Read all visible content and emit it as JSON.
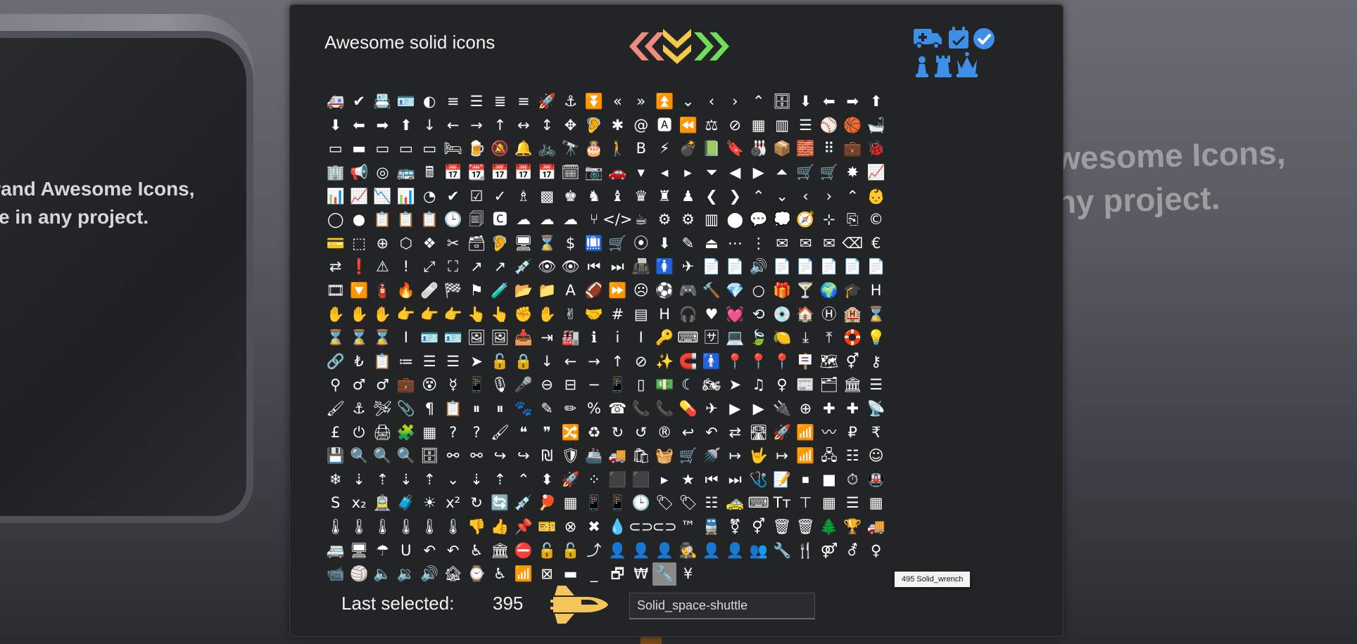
{
  "background": {
    "left_text": "Brand Awesome Icons,\nure in any project.",
    "right_text": "wesome Icons,\nny project."
  },
  "panel": {
    "title": "Awesome solid icons",
    "nav_icons": [
      "angle-double-left-icon",
      "angle-double-down-icon",
      "angle-double-right-icon"
    ],
    "header_icons": [
      "ambulance-icon",
      "calendar-check-icon",
      "check-circle-icon",
      "chess-pawn-icon",
      "chess-rook-icon",
      "chess-queen-icon"
    ],
    "colors": {
      "left_arrow": "#f08a7e",
      "down_arrow": "#f7c948",
      "right_arrow": "#6fdc5a",
      "accent_blue": "#3d8fe8",
      "shuttle": "#f6c55a"
    }
  },
  "grid": {
    "rows": [
      [
        "🚑",
        "✔",
        "📇",
        "🪪",
        "◐",
        "≡",
        "☰",
        "≣",
        "≡",
        "🚀",
        "⚓",
        "⏬",
        "«",
        "»",
        "⏫",
        "⌄",
        "‹",
        "›",
        "⌃",
        "🗄",
        "⬇",
        "⬅",
        "➡",
        "⬆",
        "⬇"
      ],
      [
        "⬅",
        "➡",
        "⬆",
        "↓",
        "←",
        "→",
        "↑",
        "↔",
        "↕",
        "✥",
        "🦻",
        "✱",
        "@",
        "🅰",
        "⏪",
        "⚖",
        "⊘",
        "▦",
        "▥",
        "☰",
        "⚾",
        "🏀",
        "🛁",
        "▭",
        "▬"
      ],
      [
        "▭",
        "▭",
        "▭",
        "🛏",
        "🍺",
        "🔕",
        "🔔",
        "🚲",
        "🔭",
        "🎂",
        "🚶",
        "B",
        "⚡",
        "💣",
        "📗",
        "🔖",
        "🎳",
        "📦",
        "🧱",
        "⠿",
        "💼",
        "🐞",
        "🏢",
        "📢",
        "◎"
      ],
      [
        "🚌",
        "🖩",
        "📅",
        "📆",
        "📅",
        "📅",
        "📅",
        "🗓",
        "📷",
        "🚗",
        "▾",
        "◂",
        "▸",
        "⏷",
        "◀",
        "▶",
        "⏶",
        "🛒",
        "🛒",
        "✸",
        "📈",
        "📊",
        "📈",
        "📉",
        "📊"
      ],
      [
        "◔",
        "✔",
        "☑",
        "✓",
        "♗",
        "▩",
        "♚",
        "♞",
        "♝",
        "♛",
        "♜",
        "♟",
        "❮",
        "❯",
        "⌃",
        "⌄",
        "‹",
        "›",
        "⌃",
        "👶",
        "◯",
        "●",
        "📋",
        "📋",
        "📋"
      ],
      [
        "🕒",
        "🗐",
        "🅲",
        "☁",
        "☁",
        "☁",
        "⑂",
        "</>",
        "☕",
        "⚙",
        "⚙",
        "▥",
        "⬤",
        "💬",
        "💭",
        "🧭",
        "⊹",
        "⎘",
        "©",
        "💳",
        "⬚",
        "⊕",
        "⬡",
        "❖",
        "✂"
      ],
      [
        "🗃",
        "🦻",
        "🖥",
        "⌛",
        "$",
        "🛄",
        "🛒",
        "⦿",
        "⬇",
        "✎",
        "⏏",
        "⋯",
        "⋮",
        "✉",
        "✉",
        "✉",
        "⌫",
        "€",
        "⇄",
        "❗",
        "⚠",
        "!",
        "⤢",
        "⛶",
        "↗"
      ],
      [
        "↗",
        "💉",
        "👁",
        "👁",
        "⏮",
        "⏭",
        "📠",
        "🚺",
        "✈",
        "📄",
        "📄",
        "🔊",
        "📄",
        "📄",
        "📄",
        "📄",
        "📄",
        "🎞",
        "🔽",
        "🧯",
        "🔥",
        "🩹",
        "🏁",
        "⚑"
      ],
      [
        "🧪",
        "📂",
        "📁",
        "A",
        "🏈",
        "⏩",
        "☹",
        "⚽",
        "🎮",
        "🔨",
        "💎",
        "○",
        "🎁",
        "🍸",
        "🌍",
        "🎓",
        "H",
        "✋",
        "✋",
        "✋",
        "👉",
        "👉",
        "👉",
        "👆",
        "👆"
      ],
      [
        "✊",
        "✋",
        "✌",
        "🤝",
        "#",
        "▤",
        "H",
        "🎧",
        "♥",
        "💓",
        "⟲",
        "💿",
        "🏠",
        "Ⓗ",
        "🏨",
        "⌛",
        "⌛",
        "⌛",
        "⌛",
        "I",
        "🪪",
        "🪪",
        "🖼",
        "🖼",
        "📥"
      ],
      [
        "⇥",
        "🏭",
        "ℹ",
        "i",
        "I",
        "🔑",
        "⌨",
        "🈂",
        "💻",
        "🍃",
        "🍋",
        "⤓",
        "⤒",
        "🛟",
        "💡",
        "🔗",
        "₺",
        "📋",
        "≔",
        "☰",
        "☰",
        "➤",
        "🔓",
        "🔒",
        "↓"
      ],
      [
        "←",
        "→",
        "↑",
        "⊘",
        "✨",
        "🧲",
        "🚹",
        "📍",
        "📍",
        "📍",
        "🪧",
        "🗺",
        "⚥",
        "⚷",
        "⚲",
        "♂",
        "♂",
        "💼",
        "😵",
        "☿",
        "📱",
        "🎙",
        "🎤",
        "⊖",
        "⊟"
      ],
      [
        "−",
        "📱",
        "▯",
        "💵",
        "☾",
        "🏍",
        "➤",
        "♫",
        "♀",
        "📰",
        "🗂",
        "🏛",
        "☰",
        "🖌",
        "⚓",
        "🛩",
        "📎",
        "¶",
        "📋",
        "⏸",
        "⏸",
        "🐾",
        "✎",
        "✏",
        "%"
      ],
      [
        "☎",
        "📞",
        "📞",
        "💊",
        "✈",
        "▶",
        "▶",
        "🔌",
        "⊕",
        "✚",
        "✚",
        "📡",
        "£",
        "⏻",
        "🖨",
        "🧩",
        "▦",
        "?",
        "?",
        "🖌",
        "❝",
        "❞",
        "🔀",
        "♻",
        "↻"
      ],
      [
        "↺",
        "®",
        "↩",
        "↶",
        "⇄",
        "🛣",
        "🚀",
        "📶",
        "〰",
        "₽",
        "₹",
        "💾",
        "🔍",
        "🔍",
        "🔍",
        "🗄",
        "⚯",
        "⚯",
        "↪",
        "↪",
        "₪",
        "🛡",
        "🚢",
        "🚚",
        "🛍"
      ],
      [
        "🧺",
        "🛒",
        "🚿",
        "↦",
        "🤟",
        "↦",
        "📶",
        "🖧",
        "☷",
        "☺",
        "❄",
        "⇣",
        "⇡",
        "⇣",
        "⇡",
        "⌄",
        "⇣",
        "⇡",
        "⌃",
        "⬍",
        "🚀",
        "⁘",
        "⬛",
        "⬛",
        "▸"
      ],
      [
        "★",
        "⏮",
        "⏭",
        "🩺",
        "📝",
        "⏹",
        "■",
        "⏱",
        "🚇",
        "S",
        "x₂",
        "🚊",
        "🧳",
        "☀",
        "x²",
        "↻",
        "🔄",
        "💉",
        "🏓",
        "▦",
        "📱",
        "📱",
        "🕒",
        "🏷",
        "🏷"
      ],
      [
        "☷",
        "🚕",
        "⌨",
        "Tт",
        "⊤",
        "▦",
        "☰",
        "▦",
        "🌡",
        "🌡",
        "🌡",
        "🌡",
        "🌡",
        "🌡",
        "👎",
        "👍",
        "📌",
        "🎫",
        "⊗",
        "✖",
        "💧",
        "⊂⊃",
        "⊂⊃",
        "™",
        "🚆"
      ],
      [
        "⚧",
        "⚥",
        "🗑",
        "🗑",
        "🌲",
        "🏆",
        "🚚",
        "🚐",
        "🖥",
        "☂",
        "U",
        "↶",
        "↶",
        "♿",
        "🏛",
        "⛔",
        "🔓",
        "🔓",
        "⤴",
        "👤",
        "👤",
        "👤",
        "🕵",
        "👤",
        "👤"
      ],
      [
        "👥",
        "🔧",
        "🍴",
        "⚤",
        "⚦",
        "♀",
        "📹",
        "🏐",
        "🔈",
        "🔉",
        "🔊",
        "🏚",
        "⌚",
        "♿",
        "📶",
        "⊠",
        "▬",
        "_",
        "🗗",
        "₩",
        "🔧",
        "¥"
      ]
    ],
    "selected_index": 495,
    "tooltip_text": "495 Solid_wrench"
  },
  "footer": {
    "last_selected_label": "Last selected:",
    "last_selected_value": "395",
    "preview_icon": "space-shuttle-icon",
    "name_field_value": "Solid_space-shuttle"
  }
}
